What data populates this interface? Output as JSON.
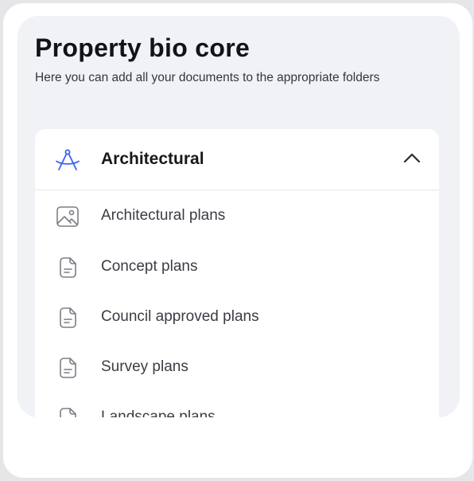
{
  "page": {
    "title": "Property bio core",
    "subtitle": "Here you can add all your documents to the appropriate folders"
  },
  "section": {
    "label": "Architectural",
    "icon": "drafting-compass-icon",
    "expanded": true,
    "accent_color": "#3d63f0"
  },
  "documents": [
    {
      "label": "Architectural plans",
      "icon": "image-icon"
    },
    {
      "label": "Concept plans",
      "icon": "document-icon"
    },
    {
      "label": "Council approved plans",
      "icon": "document-icon"
    },
    {
      "label": "Survey plans",
      "icon": "document-icon"
    },
    {
      "label": "Landscape plans",
      "icon": "document-icon"
    }
  ]
}
